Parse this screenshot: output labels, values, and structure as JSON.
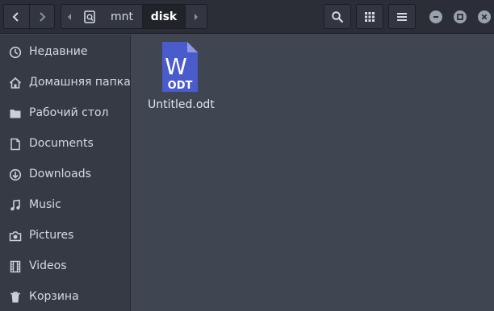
{
  "header": {
    "path": {
      "segments": [
        "mnt",
        "disk"
      ],
      "active": "disk"
    },
    "buttons": {
      "back": "chevron-left-icon",
      "forward": "chevron-right-icon",
      "search": "search-icon",
      "view": "grid-icon",
      "menu": "hamburger-icon"
    },
    "window_controls": [
      "minimize-icon",
      "maximize-icon",
      "close-icon"
    ]
  },
  "sidebar": {
    "items": [
      {
        "label": "Недавние",
        "icon": "clock-icon"
      },
      {
        "label": "Домашняя папка",
        "icon": "home-icon"
      },
      {
        "label": "Рабочий стол",
        "icon": "folder-icon"
      },
      {
        "label": "Documents",
        "icon": "document-icon"
      },
      {
        "label": "Downloads",
        "icon": "download-icon"
      },
      {
        "label": "Music",
        "icon": "music-icon"
      },
      {
        "label": "Pictures",
        "icon": "camera-icon"
      },
      {
        "label": "Videos",
        "icon": "film-icon"
      },
      {
        "label": "Корзина",
        "icon": "trash-icon"
      }
    ]
  },
  "files": [
    {
      "name": "Untitled.odt",
      "badge_letter": "W",
      "badge_type": "ODT",
      "icon": "odt-file-icon"
    }
  ],
  "colors": {
    "headerbar": "#2b2e37",
    "sidebar": "#363a44",
    "content": "#3f4651",
    "file_icon": "#4a5bcb",
    "text": "#d3dae3"
  }
}
